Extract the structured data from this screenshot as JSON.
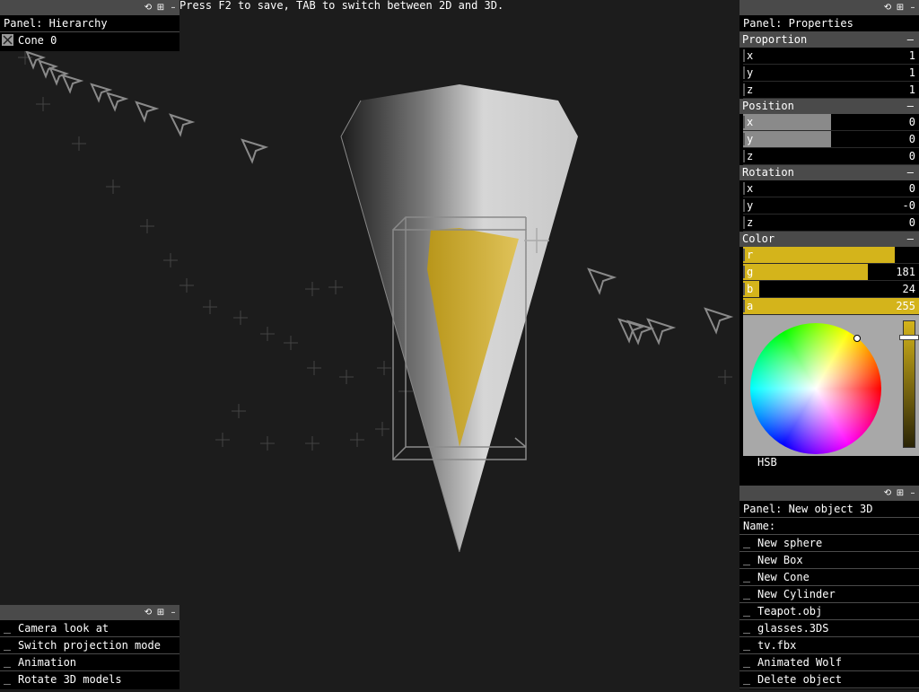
{
  "hint": "Press F2 to save, TAB to switch between 2D and 3D.",
  "colors": {
    "accent": "#d4b41b",
    "panel_header": "#4a4a4a",
    "background": "#1c1c1c"
  },
  "window_controls": {
    "refresh": "⟲",
    "dock": "⊞",
    "minimize": "–"
  },
  "hierarchy": {
    "title": "Panel: Hierarchy",
    "items": [
      {
        "label": "Cone 0"
      }
    ]
  },
  "actions_panel": {
    "items": [
      {
        "label": "Camera look at"
      },
      {
        "label": "Switch projection mode"
      },
      {
        "label": "Animation"
      },
      {
        "label": "Rotate 3D models"
      }
    ]
  },
  "properties": {
    "title": "Panel: Properties",
    "proportion": {
      "label": "Proportion",
      "x": {
        "label": "x",
        "value": "1"
      },
      "y": {
        "label": "y",
        "value": "1"
      },
      "z": {
        "label": "z",
        "value": "1"
      }
    },
    "position": {
      "label": "Position",
      "x": {
        "label": "x",
        "value": "0"
      },
      "y": {
        "label": "y",
        "value": "0"
      },
      "z": {
        "label": "z",
        "value": "0"
      }
    },
    "rotation": {
      "label": "Rotation",
      "x": {
        "label": "x",
        "value": "0"
      },
      "y": {
        "label": "y",
        "value": "-0"
      },
      "z": {
        "label": "z",
        "value": "0"
      }
    },
    "color": {
      "label": "Color",
      "r": {
        "label": "r",
        "value": "",
        "level": 0.86
      },
      "g": {
        "label": "g",
        "value": "181",
        "level": 0.71
      },
      "b": {
        "label": "b",
        "value": "24",
        "level": 0.09
      },
      "a": {
        "label": "a",
        "value": "255",
        "level": 1.0
      },
      "mode": "HSB"
    },
    "group_toggle": "–"
  },
  "new_object": {
    "title": "Panel: New object 3D",
    "name_label": "Name:",
    "items": [
      {
        "label": "New sphere"
      },
      {
        "label": "New Box"
      },
      {
        "label": "New Cone"
      },
      {
        "label": "New Cylinder"
      },
      {
        "label": "Teapot.obj"
      },
      {
        "label": "glasses.3DS"
      },
      {
        "label": "tv.fbx"
      },
      {
        "label": "Animated Wolf"
      },
      {
        "label": "Delete object"
      }
    ]
  }
}
